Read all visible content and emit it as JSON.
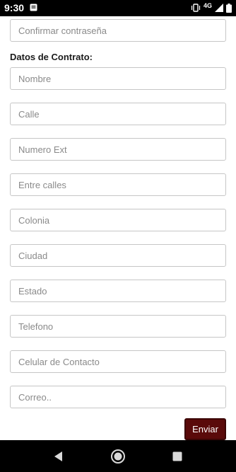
{
  "status_bar": {
    "time": "9:30",
    "network": "4G",
    "icons": [
      "message-icon",
      "vibrate-icon",
      "signal-icon",
      "battery-icon"
    ]
  },
  "form": {
    "confirm_password_placeholder": "Confirmar contraseña",
    "contract_section_title": "Datos de Contrato:",
    "fields": [
      {
        "placeholder": "Nombre"
      },
      {
        "placeholder": "Calle"
      },
      {
        "placeholder": "Numero Ext"
      },
      {
        "placeholder": "Entre calles"
      },
      {
        "placeholder": "Colonia"
      },
      {
        "placeholder": "Ciudad"
      },
      {
        "placeholder": "Estado"
      },
      {
        "placeholder": "Telefono"
      },
      {
        "placeholder": "Celular de Contacto"
      },
      {
        "placeholder": "Correo.."
      }
    ],
    "submit_label": "Enviar"
  },
  "colors": {
    "submit_button": "#5a0a0a",
    "field_border": "#c6c6c6",
    "system_bars": "#000000"
  },
  "nav_bar": {
    "icons": [
      "back-icon",
      "home-icon",
      "recents-icon"
    ]
  }
}
